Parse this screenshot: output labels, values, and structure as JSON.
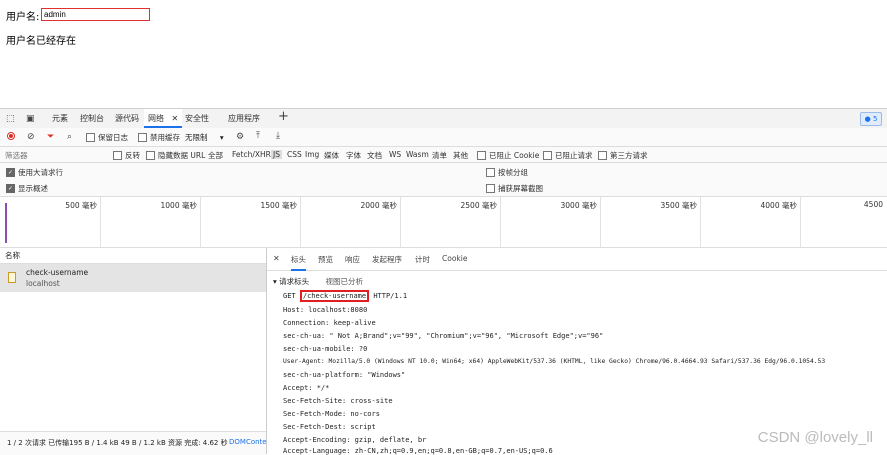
{
  "page": {
    "username_label": "用户名:",
    "username_value": "admin",
    "message": "用户名已经存在"
  },
  "devtools": {
    "tabs": [
      {
        "label": "元素"
      },
      {
        "label": "控制台"
      },
      {
        "label": "源代码"
      },
      {
        "label": "网络",
        "active": true
      },
      {
        "label": "安全性"
      },
      {
        "label": "应用程序"
      }
    ],
    "issues_count": "5",
    "toolbar": {
      "preserve_log": "保留日志",
      "disable_cache": "禁用缓存",
      "throttle": "无限制"
    },
    "filter": {
      "placeholder": "筛选器",
      "invert": "反转",
      "hide_data_url": "隐藏数据 URL",
      "types": [
        "全部",
        "Fetch/XHR",
        "JS",
        "CSS",
        "Img",
        "媒体",
        "字体",
        "文档",
        "WS",
        "Wasm",
        "清单",
        "其他"
      ],
      "active_type": "JS",
      "blocked_cookies": "已阻止 Cookie",
      "blocked_requests": "已阻止请求",
      "third_party": "第三方请求"
    },
    "options": {
      "large_rows": "使用大请求行",
      "overview": "显示概述",
      "group_by_frame": "按帧分组",
      "screenshots": "捕获屏幕截图"
    },
    "timeline_ticks": [
      "500 毫秒",
      "1000 毫秒",
      "1500 毫秒",
      "2000 毫秒",
      "2500 毫秒",
      "3000 毫秒",
      "3500 毫秒",
      "4000 毫秒",
      "4500"
    ],
    "request_list": {
      "header": "名称",
      "items": [
        {
          "name": "check-username",
          "host": "localhost"
        }
      ],
      "status": "1 / 2 次请求  已传输195 B / 1.4 kB  49 B / 1.2 kB 资源  完成: 4.62 秒",
      "dom_link": "DOMConte"
    },
    "detail": {
      "tabs": [
        "标头",
        "预览",
        "响应",
        "发起程序",
        "计时",
        "Cookie"
      ],
      "active_tab": "标头",
      "section_title": "请求标头",
      "view_parsed": "视图已分析",
      "request_line": {
        "method": "GET",
        "path": "/check-username",
        "protocol": "HTTP/1.1"
      },
      "headers": [
        "Host: localhost:8080",
        "Connection: keep-alive",
        "sec-ch-ua: \" Not A;Brand\";v=\"99\", \"Chromium\";v=\"96\", \"Microsoft Edge\";v=\"96\"",
        "sec-ch-ua-mobile: ?0",
        "User-Agent: Mozilla/5.0 (Windows NT 10.0; Win64; x64) AppleWebKit/537.36 (KHTML, like Gecko) Chrome/96.0.4664.93 Safari/537.36 Edg/96.0.1054.53",
        "sec-ch-ua-platform: \"Windows\"",
        "Accept: */*",
        "Sec-Fetch-Site: cross-site",
        "Sec-Fetch-Mode: no-cors",
        "Sec-Fetch-Dest: script",
        "Accept-Encoding: gzip, deflate, br",
        "Accept-Language: zh-CN,zh;q=0.9,en;q=0.8,en-GB;q=0.7,en-US;q=0.6"
      ]
    }
  },
  "watermark": "CSDN @lovely_ll",
  "colors": {
    "accent": "#1a73e8",
    "highlight": "#e02020",
    "record": "#d93025"
  }
}
